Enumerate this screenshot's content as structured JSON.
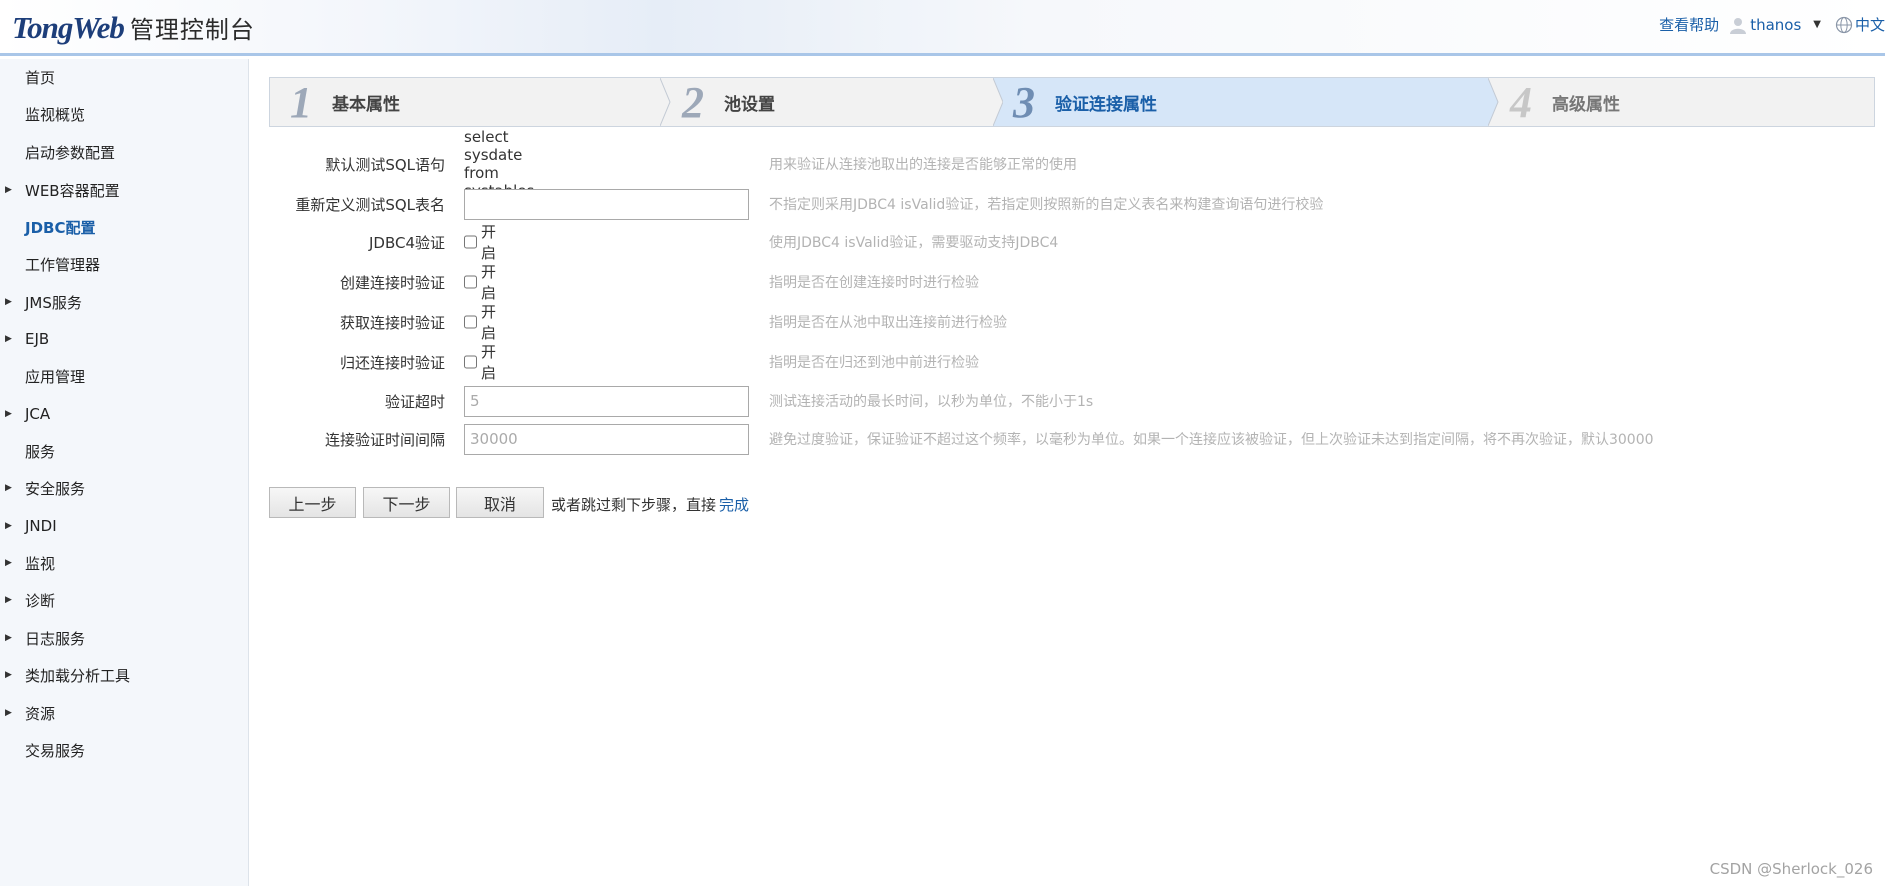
{
  "header": {
    "logo_text": "TongWeb",
    "logo_subtitle": "管理控制台",
    "help_link": "查看帮助",
    "user_name": "thanos",
    "language": "中文"
  },
  "sidebar": {
    "items": [
      {
        "label": "首页",
        "has_arrow": false
      },
      {
        "label": "监视概览",
        "has_arrow": false
      },
      {
        "label": "启动参数配置",
        "has_arrow": false
      },
      {
        "label": "WEB容器配置",
        "has_arrow": true
      },
      {
        "label": "JDBC配置",
        "has_arrow": false,
        "active": true
      },
      {
        "label": "工作管理器",
        "has_arrow": false
      },
      {
        "label": "JMS服务",
        "has_arrow": true
      },
      {
        "label": "EJB",
        "has_arrow": true
      },
      {
        "label": "应用管理",
        "has_arrow": false
      },
      {
        "label": "JCA",
        "has_arrow": true
      },
      {
        "label": "服务",
        "has_arrow": false
      },
      {
        "label": "安全服务",
        "has_arrow": true
      },
      {
        "label": "JNDI",
        "has_arrow": true
      },
      {
        "label": "监视",
        "has_arrow": true
      },
      {
        "label": "诊断",
        "has_arrow": true
      },
      {
        "label": "日志服务",
        "has_arrow": true
      },
      {
        "label": "类加载分析工具",
        "has_arrow": true
      },
      {
        "label": "资源",
        "has_arrow": true
      },
      {
        "label": "交易服务",
        "has_arrow": false
      }
    ]
  },
  "wizard": {
    "current_step": 3,
    "steps": [
      {
        "number": "1",
        "label": "基本属性"
      },
      {
        "number": "2",
        "label": "池设置"
      },
      {
        "number": "3",
        "label": "验证连接属性"
      },
      {
        "number": "4",
        "label": "高级属性"
      }
    ]
  },
  "form": {
    "default_sql": {
      "label": "默认测试SQL语句",
      "value": "select sysdate from systables",
      "help": "用来验证从连接池取出的连接是否能够正常的使用"
    },
    "redefine_table": {
      "label": "重新定义测试SQL表名",
      "value": "",
      "help": "不指定则采用JDBC4 isValid验证，若指定则按照新的自定义表名来构建查询语句进行校验"
    },
    "jdbc4_validate": {
      "label": "JDBC4验证",
      "option": "开启",
      "checked": false,
      "help": "使用JDBC4 isValid验证，需要驱动支持JDBC4"
    },
    "validate_on_create": {
      "label": "创建连接时验证",
      "option": "开启",
      "checked": false,
      "help": "指明是否在创建连接时时进行检验"
    },
    "validate_on_get": {
      "label": "获取连接时验证",
      "option": "开启",
      "checked": false,
      "help": "指明是否在从池中取出连接前进行检验"
    },
    "validate_on_return": {
      "label": "归还连接时验证",
      "option": "开启",
      "checked": false,
      "help": "指明是否在归还到池中前进行检验"
    },
    "validate_timeout": {
      "label": "验证超时",
      "placeholder": "5",
      "help": "测试连接活动的最长时间，以秒为单位，不能小于1s"
    },
    "validate_interval": {
      "label": "连接验证时间间隔",
      "placeholder": "30000",
      "help": "避免过度验证，保证验证不超过这个频率，以毫秒为单位。如果一个连接应该被验证，但上次验证未达到指定间隔，将不再次验证，默认30000"
    }
  },
  "actions": {
    "prev": "上一步",
    "next": "下一步",
    "cancel": "取消",
    "skip_text": "或者跳过剩下步骤，直接",
    "finish": "完成"
  },
  "watermark": "CSDN @Sherlock_026",
  "colors": {
    "accent": "#1a5fa8",
    "current_step_bg": "#d6e6f8",
    "help_text": "#b3b3b3"
  }
}
